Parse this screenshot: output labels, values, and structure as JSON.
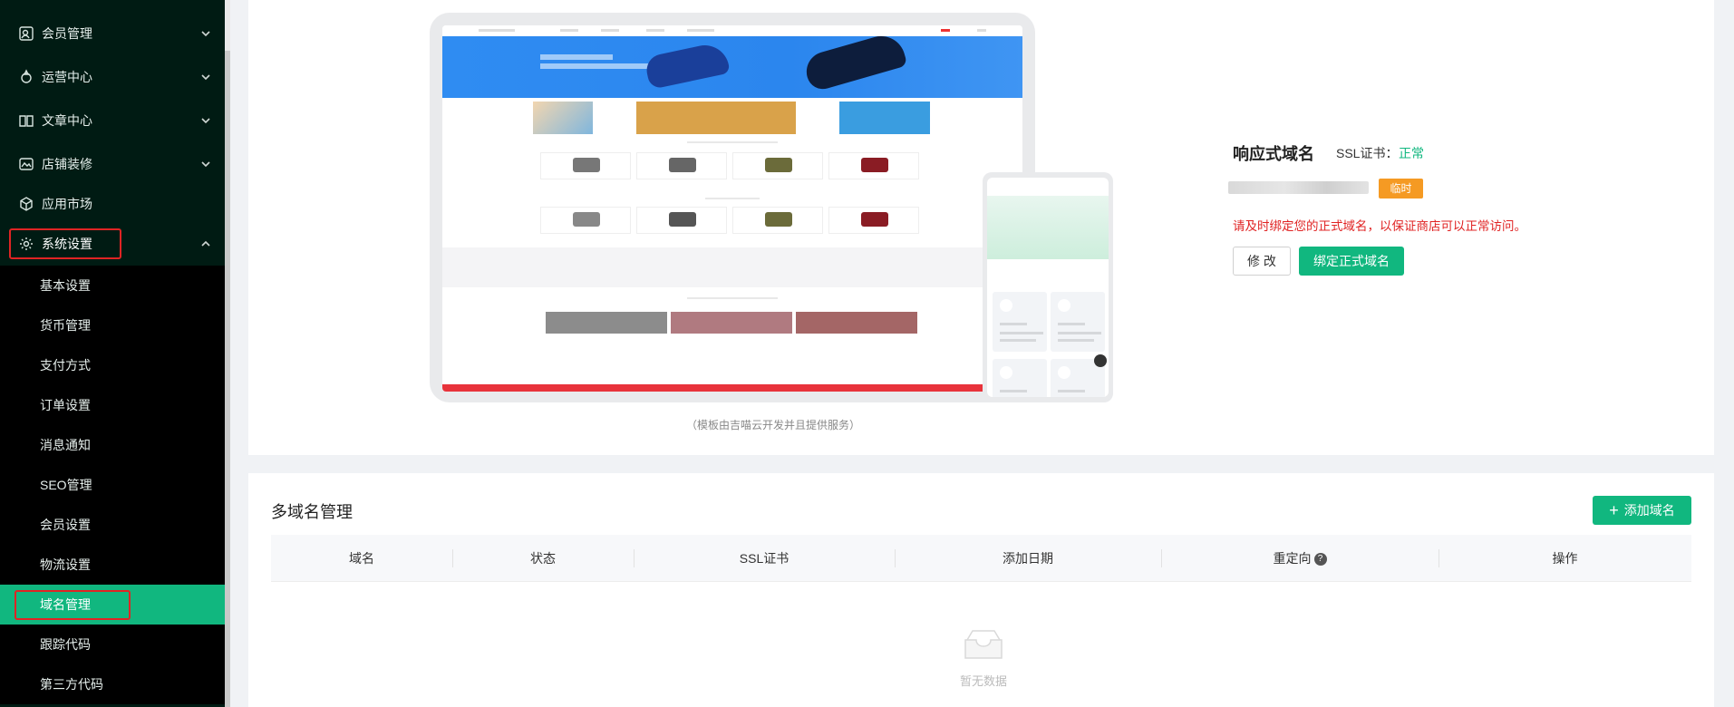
{
  "sidebar": {
    "menus": [
      {
        "label": "会员管理",
        "icon": "member-icon"
      },
      {
        "label": "运营中心",
        "icon": "operation-icon"
      },
      {
        "label": "文章中心",
        "icon": "book-icon"
      },
      {
        "label": "店铺装修",
        "icon": "decoration-icon"
      },
      {
        "label": "应用市场",
        "icon": "app-market-icon"
      },
      {
        "label": "系统设置",
        "icon": "gear-icon"
      }
    ],
    "submenus": [
      {
        "label": "基本设置"
      },
      {
        "label": "货币管理"
      },
      {
        "label": "支付方式"
      },
      {
        "label": "订单设置"
      },
      {
        "label": "消息通知"
      },
      {
        "label": "SEO管理"
      },
      {
        "label": "会员设置"
      },
      {
        "label": "物流设置"
      },
      {
        "label": "域名管理"
      },
      {
        "label": "跟踪代码"
      },
      {
        "label": "第三方代码"
      }
    ],
    "active_submenu": "域名管理"
  },
  "preview": {
    "caption": "（模板由吉喵云开发并且提供服务）"
  },
  "domain": {
    "title": "响应式域名",
    "ssl_label": "SSL证书：",
    "ssl_value": "正常",
    "temp_tag": "临时",
    "warning": "请及时绑定您的正式域名，以保证商店可以正常访问。",
    "modify_label": "修 改",
    "bind_label": "绑定正式域名"
  },
  "multi_domain": {
    "title": "多域名管理",
    "add_label": "添加域名",
    "columns": [
      "域名",
      "状态",
      "SSL证书",
      "添加日期",
      "重定向",
      "操作"
    ],
    "empty_text": "暂无数据"
  },
  "colors": {
    "primary": "#11b77f",
    "sidebar_bg": "#001b13",
    "warning": "#e02424",
    "tag_orange": "#f59a23"
  }
}
